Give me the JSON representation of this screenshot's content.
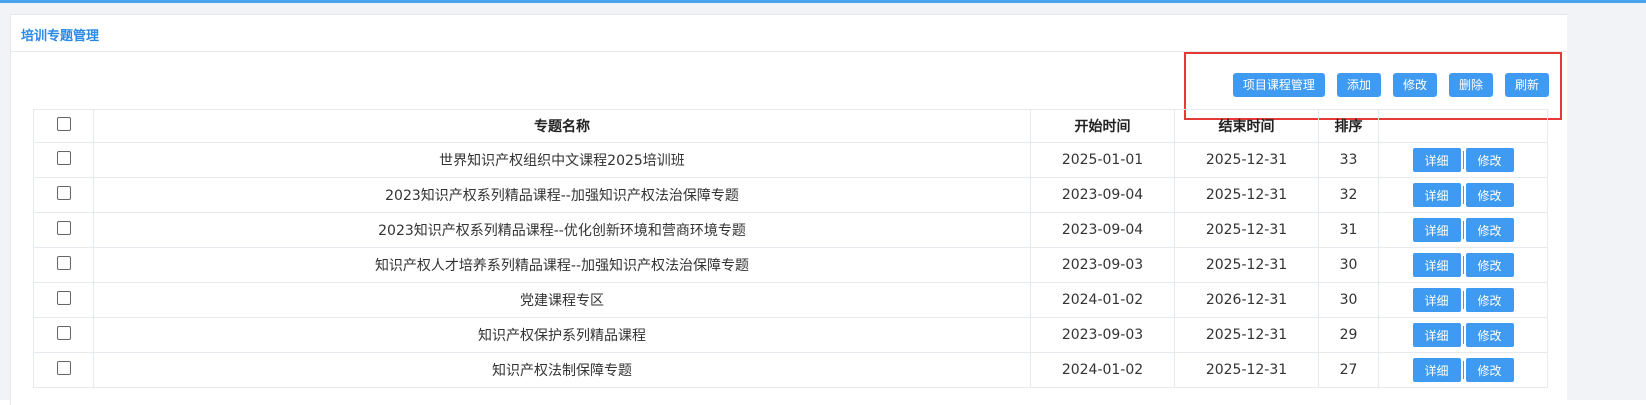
{
  "panel": {
    "title": "培训专题管理"
  },
  "toolbar": {
    "project_course_label": "项目课程管理",
    "add_label": "添加",
    "edit_label": "修改",
    "delete_label": "删除",
    "refresh_label": "刷新"
  },
  "table": {
    "headers": {
      "name": "专题名称",
      "start": "开始时间",
      "end": "结束时间",
      "order": "排序",
      "ops": ""
    },
    "row_actions": {
      "detail_label": "详细",
      "edit_label": "修改"
    },
    "rows": [
      {
        "name": "世界知识产权组织中文课程2025培训班",
        "start": "2025-01-01",
        "end": "2025-12-31",
        "order": "33"
      },
      {
        "name": "2023知识产权系列精品课程--加强知识产权法治保障专题",
        "start": "2023-09-04",
        "end": "2025-12-31",
        "order": "32"
      },
      {
        "name": "2023知识产权系列精品课程--优化创新环境和营商环境专题",
        "start": "2023-09-04",
        "end": "2025-12-31",
        "order": "31"
      },
      {
        "name": "知识产权人才培养系列精品课程--加强知识产权法治保障专题",
        "start": "2023-09-03",
        "end": "2025-12-31",
        "order": "30"
      },
      {
        "name": "党建课程专区",
        "start": "2024-01-02",
        "end": "2026-12-31",
        "order": "30"
      },
      {
        "name": "知识产权保护系列精品课程",
        "start": "2023-09-03",
        "end": "2025-12-31",
        "order": "29"
      },
      {
        "name": "知识产权法制保障专题",
        "start": "2024-01-02",
        "end": "2025-12-31",
        "order": "27"
      }
    ]
  },
  "colors": {
    "accent": "#3f9af2",
    "title": "#2b8ae6",
    "highlight": "#e53935"
  }
}
